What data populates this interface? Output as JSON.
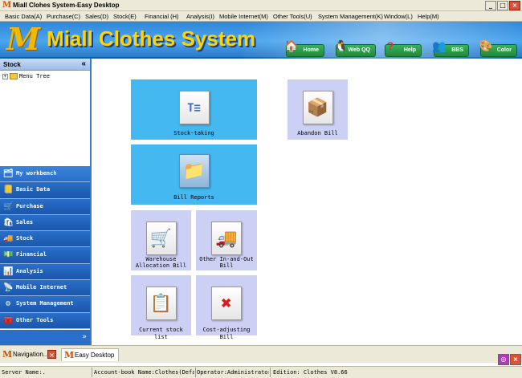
{
  "window": {
    "title": "Miall Clohes System-Easy Desktop",
    "icon": "M",
    "buttons": [
      "_",
      "□",
      "×"
    ]
  },
  "menu": [
    "Basic Data(A)",
    "Purchase(C)",
    "Sales(D)",
    "Stock(E)",
    "Financial (H)",
    "Analysis(I)",
    "Mobile Internet(M)",
    "Other Tools(U)",
    "System Management(K)",
    "Window(L)",
    "Help(M)"
  ],
  "banner": {
    "logo": "M",
    "brand": "Miall Clothes System",
    "nav": [
      "Home",
      "Web QQ",
      "Help",
      "BBS",
      "Color"
    ]
  },
  "sidebar": {
    "title": "Stock",
    "collapse": "«",
    "tree_root": "Menu Tree",
    "items": [
      "My workbench",
      "Basic Data",
      "Purchase",
      "Sales",
      "Stock",
      "Financial",
      "Analysis",
      "Mobile Internet",
      "System Management",
      "Other Tools"
    ],
    "footer": "»"
  },
  "tiles": [
    {
      "label": "Stock-taking",
      "icon": "stock-taking-icon"
    },
    {
      "label": "Abandon Bill",
      "icon": "abandon-bill-icon"
    },
    {
      "label": "Bill Reports",
      "icon": "bill-reports-icon"
    },
    {
      "label": "Warehouse Allocation Bill",
      "line1": "Warehouse",
      "line2": "Allocation Bill",
      "icon": "warehouse-allocation-icon"
    },
    {
      "label": "Other In-and-Out Bill",
      "line1": "Other In-and-Out",
      "line2": "Bill",
      "icon": "other-in-out-icon"
    },
    {
      "label": "Current stock list",
      "icon": "current-stock-icon"
    },
    {
      "label": "Cost-adjusting Bill",
      "icon": "cost-adjusting-icon"
    }
  ],
  "tabs": [
    {
      "label": "Navigation..."
    },
    {
      "label": "Easy Desktop"
    }
  ],
  "status": {
    "server": "Server Name:.",
    "account_book": "Account-book Name:Clothes(Defaul",
    "operator": "Operator:Administrator",
    "edition": "Edition:  Clothes V8.66"
  },
  "colors": {
    "tile_highlight": "#43b8f1",
    "tile_default": "#cdd0f5",
    "nav_blue": "#1f5fb8",
    "banner_blue": "#3a96e3",
    "brand_yellow": "#ffd400"
  }
}
